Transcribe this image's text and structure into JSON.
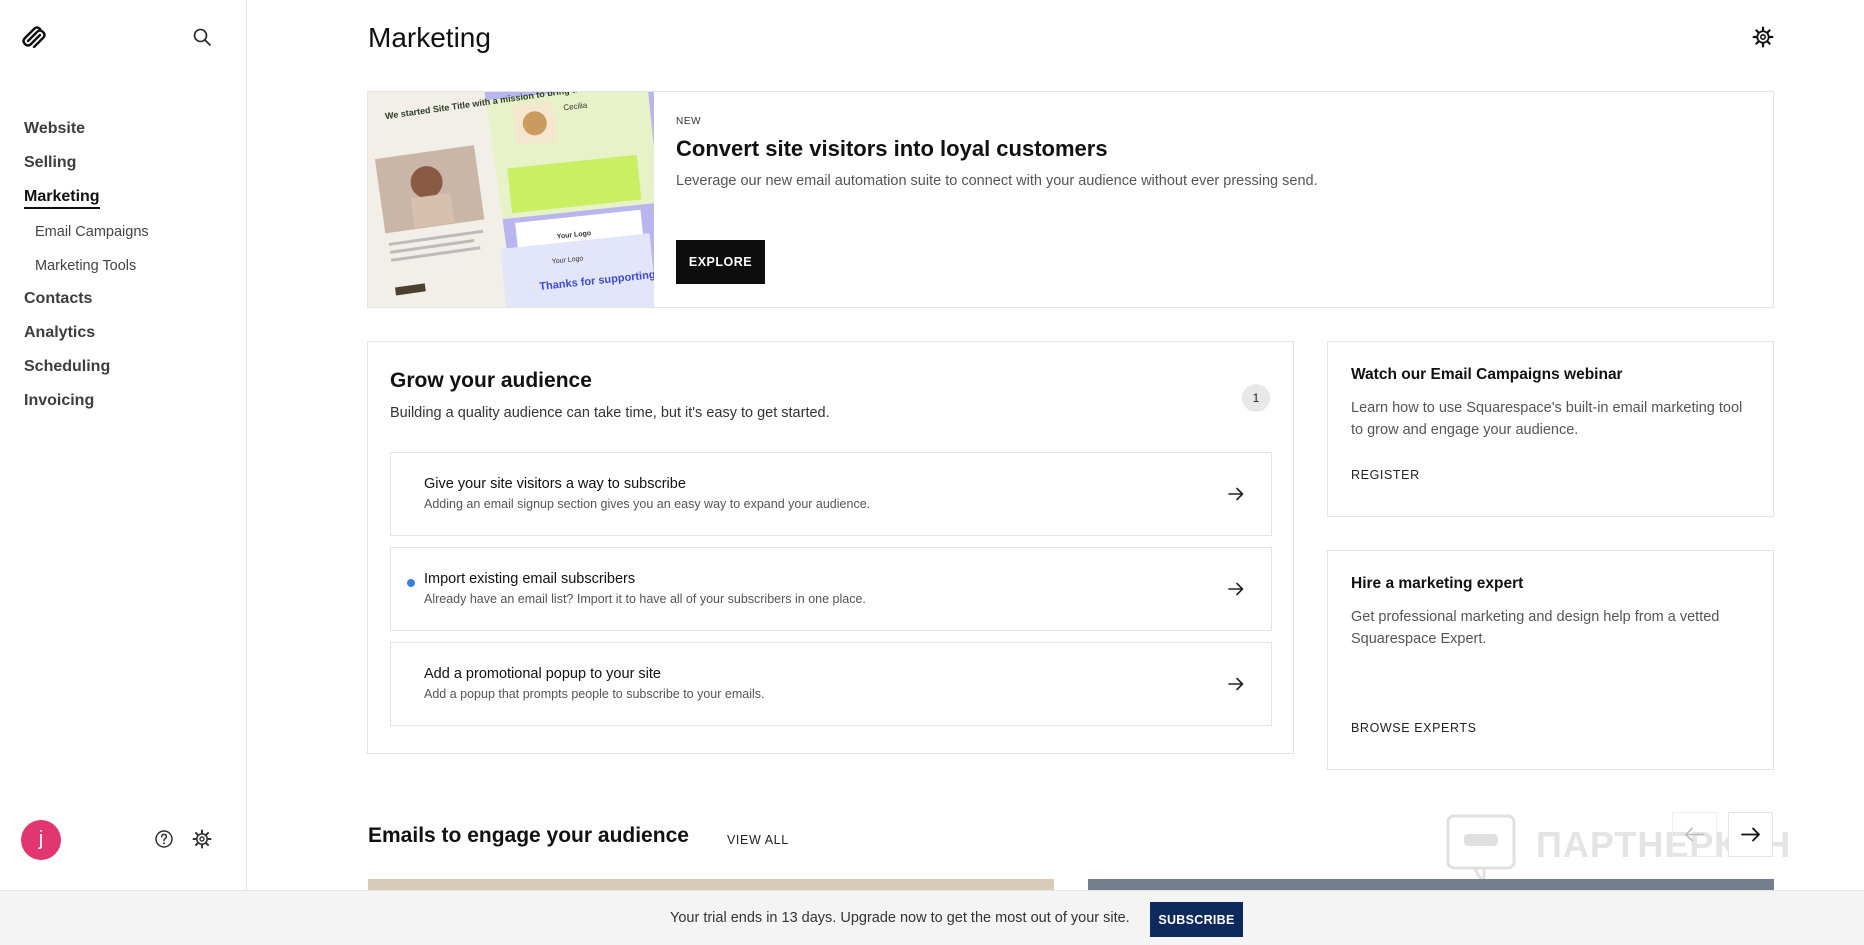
{
  "sidebar": {
    "nav": [
      {
        "label": "Website"
      },
      {
        "label": "Selling"
      },
      {
        "label": "Marketing",
        "active": true
      },
      {
        "label": "Email Campaigns",
        "sub": true
      },
      {
        "label": "Marketing Tools",
        "sub": true
      },
      {
        "label": "Contacts"
      },
      {
        "label": "Analytics"
      },
      {
        "label": "Scheduling"
      },
      {
        "label": "Invoicing"
      }
    ],
    "avatar_initial": "j"
  },
  "header": {
    "title": "Marketing"
  },
  "promo": {
    "badge": "NEW",
    "title": "Convert site visitors into loyal customers",
    "description": "Leverage our new email automation suite to connect with your audience without ever pressing send.",
    "button": "EXPLORE",
    "image_text": {
      "headline": "We started Site Title with a mission to bring the best products to people like",
      "name": "Cecilia",
      "logo": "Your Logo",
      "logo2": "Your Logo",
      "thanks": "Thanks for supporting us"
    }
  },
  "grow": {
    "title": "Grow your audience",
    "description": "Building a quality audience can take time, but it's easy to get started.",
    "badge": "1",
    "tasks": [
      {
        "title": "Give your site visitors a way to subscribe",
        "description": "Adding an email signup section gives you an easy way to expand your audience."
      },
      {
        "title": "Import existing email subscribers",
        "description": "Already have an email list? Import it to have all of your subscribers in one place."
      },
      {
        "title": "Add a promotional popup to your site",
        "description": "Add a popup that prompts people to subscribe to your emails."
      }
    ]
  },
  "webinar": {
    "title": "Watch our Email Campaigns webinar",
    "description": "Learn how to use Squarespace's built-in email marketing tool to grow and engage your audience.",
    "link": "REGISTER"
  },
  "expert": {
    "title": "Hire a marketing expert",
    "description": "Get professional marketing and design help from a vetted Squarespace Expert.",
    "link": "BROWSE EXPERTS"
  },
  "emails": {
    "title": "Emails to engage your audience",
    "view_all": "VIEW ALL"
  },
  "watermark": {
    "text": "ПАРТНЕРКИН"
  },
  "trial": {
    "text": "Your trial ends in 13 days. Upgrade now to get the most out of your site.",
    "button": "SUBSCRIBE"
  },
  "colors": {
    "accent_dark": "#0d0d0d",
    "subscribe_navy": "#0e2a5c",
    "avatar_pink": "#e23670",
    "task_dot_blue": "#3b82e0"
  },
  "icons": [
    "squarespace-logo-icon",
    "search-icon",
    "gear-icon",
    "help-icon",
    "arrow-right-icon",
    "arrow-left-icon"
  ]
}
